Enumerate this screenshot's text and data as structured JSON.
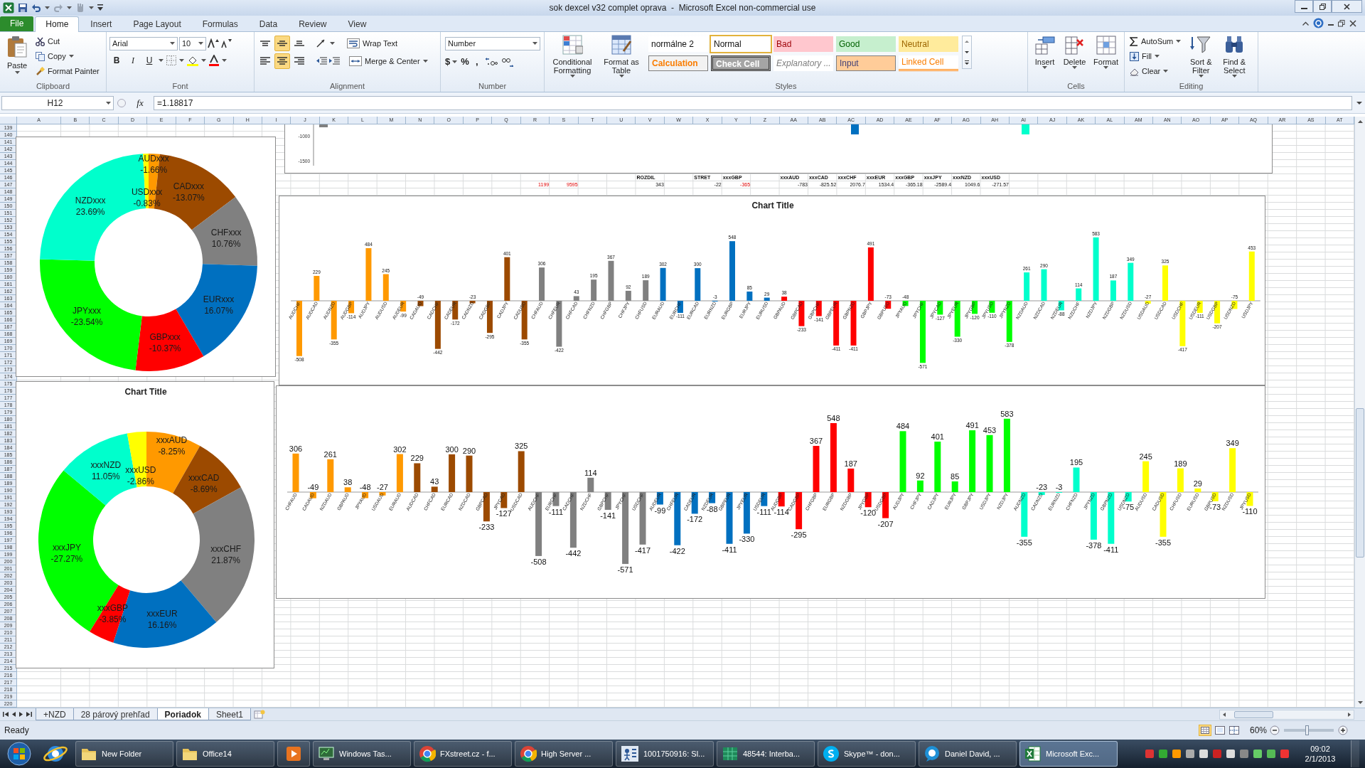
{
  "window": {
    "title": "sok dexcel v32 complet oprava  -  Microsoft Excel non-commercial use"
  },
  "ribbon_tabs": [
    {
      "label": "File",
      "kind": "file",
      "selected": false
    },
    {
      "label": "Home",
      "kind": "tab",
      "selected": true
    },
    {
      "label": "Insert",
      "kind": "tab",
      "selected": false
    },
    {
      "label": "Page Layout",
      "kind": "tab",
      "selected": false
    },
    {
      "label": "Formulas",
      "kind": "tab",
      "selected": false
    },
    {
      "label": "Data",
      "kind": "tab",
      "selected": false
    },
    {
      "label": "Review",
      "kind": "tab",
      "selected": false
    },
    {
      "label": "View",
      "kind": "tab",
      "selected": false
    }
  ],
  "clipboard": {
    "label": "Clipboard",
    "paste": "Paste",
    "cut": "Cut",
    "copy": "Copy",
    "format_painter": "Format Painter"
  },
  "font": {
    "label": "Font",
    "family": "Arial",
    "size": "10",
    "bold": "B",
    "italic": "I",
    "underline": "U"
  },
  "alignment": {
    "label": "Alignment",
    "vertical": [
      {
        "selected": false
      },
      {
        "selected": true
      },
      {
        "selected": false
      }
    ],
    "horizontal": [
      {
        "selected": false
      },
      {
        "selected": true
      },
      {
        "selected": false
      }
    ],
    "wrap_text": "Wrap Text",
    "merge_center": "Merge & Center"
  },
  "number": {
    "label": "Number",
    "format": "Number",
    "currency": "$",
    "percent": "%",
    "comma": ","
  },
  "styles": {
    "label": "Styles",
    "conditional_formatting": "Conditional Formatting",
    "format_as_table": "Format as Table",
    "gallery": [
      {
        "label": "normálne 2",
        "kind": "plain",
        "selected": false
      },
      {
        "label": "Normal",
        "kind": "normal",
        "selected": true
      },
      {
        "label": "Bad",
        "kind": "bad",
        "selected": false
      },
      {
        "label": "Good",
        "kind": "good",
        "selected": false
      },
      {
        "label": "Neutral",
        "kind": "neutral",
        "selected": false
      },
      {
        "label": "Calculation",
        "kind": "calculation",
        "selected": false
      },
      {
        "label": "Check Cell",
        "kind": "check",
        "selected": false
      },
      {
        "label": "Explanatory ...",
        "kind": "explanatory",
        "selected": false
      },
      {
        "label": "Input",
        "kind": "input",
        "selected": false
      },
      {
        "label": "Linked Cell",
        "kind": "linked",
        "selected": false
      }
    ]
  },
  "cells_group": {
    "label": "Cells",
    "insert": "Insert",
    "delete": "Delete",
    "format": "Format"
  },
  "editing": {
    "label": "Editing",
    "autosum": "AutoSum",
    "fill": "Fill",
    "clear": "Clear",
    "sort_filter": "Sort & Filter",
    "find_select": "Find & Select"
  },
  "formula_bar": {
    "name_box": "H12",
    "function_label": "fx",
    "formula": "=1.18817"
  },
  "sheet": {
    "column_headers": [
      "A",
      "B",
      "C",
      "D",
      "E",
      "F",
      "G",
      "H",
      "I",
      "J",
      "K",
      "L",
      "M",
      "N",
      "O",
      "P",
      "Q",
      "R",
      "S",
      "T",
      "U",
      "V",
      "W",
      "X",
      "Y",
      "Z",
      "AA",
      "AB",
      "AC",
      "AD",
      "AE",
      "AF",
      "AG",
      "AH",
      "AI",
      "AJ",
      "AK",
      "AL",
      "AM",
      "AN",
      "AO",
      "AP",
      "AQ",
      "AR",
      "AS",
      "AT"
    ],
    "row_numbers": [
      "139",
      "140",
      "141",
      "142",
      "143",
      "144",
      "145",
      "146",
      "147",
      "148",
      "149",
      "150",
      "151",
      "152",
      "153",
      "154",
      "155",
      "156",
      "157",
      "158",
      "159",
      "160",
      "161",
      "162",
      "163",
      "164",
      "165",
      "166",
      "167",
      "168",
      "169",
      "170",
      "171",
      "172",
      "173",
      "174",
      "175",
      "176",
      "177",
      "178",
      "179",
      "180",
      "181",
      "182",
      "183",
      "184",
      "185",
      "186",
      "187",
      "188",
      "189",
      "190",
      "191",
      "192",
      "193",
      "194",
      "195",
      "196",
      "197",
      "198",
      "199",
      "200",
      "201",
      "202",
      "203",
      "204",
      "205",
      "206",
      "207",
      "208",
      "209",
      "210",
      "211",
      "212",
      "213",
      "214",
      "215",
      "216",
      "217",
      "218",
      "219",
      "220"
    ],
    "cell_rows": [
      {
        "cells": [
          {
            "text": "ROZDIL",
            "kind": "header",
            "flagged": false
          },
          {
            "text": "STRET",
            "kind": "header",
            "flagged": false
          },
          {
            "text": "xxxGBP",
            "kind": "header",
            "flagged": false
          },
          {
            "text": "xxxAUD",
            "kind": "header",
            "flagged": false
          },
          {
            "text": "xxxCAD",
            "kind": "header",
            "flagged": false
          },
          {
            "text": "xxxCHF",
            "kind": "header",
            "flagged": false
          },
          {
            "text": "xxxEUR",
            "kind": "header",
            "flagged": false
          },
          {
            "text": "xxxGBP",
            "kind": "header",
            "flagged": false
          },
          {
            "text": "xxxJPY",
            "kind": "header",
            "flagged": false
          },
          {
            "text": "xxxNZD",
            "kind": "header",
            "flagged": false
          },
          {
            "text": "xxxUSD",
            "kind": "header",
            "flagged": false
          }
        ]
      },
      {
        "cells": [
          {
            "text": "1199",
            "kind": "value",
            "flagged": true
          },
          {
            "text": "9595",
            "kind": "value",
            "flagged": true
          },
          {
            "text": "343",
            "kind": "value",
            "flagged": false
          },
          {
            "text": "-22",
            "kind": "value",
            "flagged": false
          },
          {
            "text": "-365",
            "kind": "value",
            "flagged": true
          },
          {
            "text": "-783",
            "kind": "value",
            "flagged": false
          },
          {
            "text": "-825.52",
            "kind": "value",
            "flagged": false
          },
          {
            "text": "2076.7",
            "kind": "value",
            "flagged": false
          },
          {
            "text": "1534.4",
            "kind": "value",
            "flagged": false
          },
          {
            "text": "-365.18",
            "kind": "value",
            "flagged": false
          },
          {
            "text": "-2589.4",
            "kind": "value",
            "flagged": false
          },
          {
            "text": "1049.6",
            "kind": "value",
            "flagged": false
          },
          {
            "text": "-271.57",
            "kind": "value",
            "flagged": false
          }
        ]
      }
    ]
  },
  "chart_fragment": {
    "axis_labels": [
      "-1000",
      "-1500"
    ]
  },
  "charts": [
    {
      "slices": [
        {
          "color": "#ff9900"
        },
        {
          "color": "#9c4a00"
        },
        {
          "color": "#808080"
        },
        {
          "color": "#0070c0"
        },
        {
          "color": "#ff0000"
        },
        {
          "color": "#00ff00"
        },
        {
          "color": "#00ffcc"
        },
        {
          "color": "#ffff00"
        }
      ],
      "chart_data": {
        "type": "donut",
        "categories": [
          "AUDxxx",
          "CADxxx",
          "CHFxxx",
          "EURxxx",
          "GBPxxx",
          "JPYxxx",
          "NZDxxx",
          "USDxxx"
        ],
        "series": [
          {
            "values": [
              1.66,
              13.07,
              10.76,
              16.07,
              10.37,
              23.54,
              23.69,
              0.83
            ]
          }
        ],
        "value_labels": [
          "-1.66%",
          "-13.07%",
          "10.76%",
          "16.07%",
          "-10.37%",
          "-23.54%",
          "23.69%",
          "-0.83%"
        ]
      }
    },
    {
      "chart_data": {
        "type": "bar",
        "title": "Chart Title",
        "categories": [
          "AUDCHF",
          "AUDCAD",
          "AUDNZD",
          "AUDGBP",
          "AUDJPY",
          "AUDUSD",
          "AUDEUR",
          "CADAUD",
          "CADCHF",
          "CADEUR",
          "CADNZD",
          "CADGBP",
          "CADJPY",
          "CADUSD",
          "CHFAUD",
          "CHFEUR",
          "CHFCAD",
          "CHFNZD",
          "CHFGBP",
          "CHFJPY",
          "CHFUSD",
          "EURAUD",
          "EURCHF",
          "EURCAD",
          "EURNZD",
          "EURGBP",
          "EURJPY",
          "EURUSD",
          "GBPAUD",
          "GBPCAD",
          "GBPCHF",
          "GBPEUR",
          "GBPNZD",
          "GBPJPY",
          "GBPUSD",
          "JPYAUD",
          "JPYCHF",
          "JPYCAD",
          "JPYEUR",
          "JPYGBP",
          "JPYUSD",
          "JPYNZD",
          "NZDAUD",
          "NZDCAD",
          "NZDEUR",
          "NZDCHF",
          "NZDJPY",
          "NZDGBP",
          "NZDUSD",
          "USDAUD",
          "USDCAD",
          "USDCHF",
          "USDEUR",
          "USDGBP",
          "USDNZD",
          "USDJPY"
        ],
        "series": [
          {
            "color": "#ff9900",
            "values": [
              -508,
              229,
              -355,
              -114,
              484,
              245,
              -99,
              null,
              null,
              null,
              null,
              null,
              null,
              null,
              null,
              null,
              null,
              null,
              null,
              null,
              null,
              null,
              null,
              null,
              null,
              null,
              null,
              null,
              null,
              null,
              null,
              null,
              null,
              null,
              null,
              null,
              null,
              null,
              null,
              null,
              null,
              null,
              null,
              null,
              null,
              null,
              null,
              null,
              null,
              null,
              null,
              null,
              null,
              null,
              null,
              null
            ]
          },
          {
            "color": "#9c4a00",
            "values": [
              null,
              null,
              null,
              null,
              null,
              null,
              null,
              -49,
              -442,
              -172,
              -23,
              -295,
              401,
              -355,
              null,
              null,
              null,
              null,
              null,
              null,
              null,
              null,
              null,
              null,
              null,
              null,
              null,
              null,
              null,
              null,
              null,
              null,
              null,
              null,
              null,
              null,
              null,
              null,
              null,
              null,
              null,
              null,
              null,
              null,
              null,
              null,
              null,
              null,
              null,
              null,
              null,
              null,
              null,
              null,
              null,
              null
            ]
          },
          {
            "color": "#808080",
            "values": [
              null,
              null,
              null,
              null,
              null,
              null,
              null,
              null,
              null,
              null,
              null,
              null,
              null,
              null,
              306,
              -422,
              43,
              195,
              367,
              92,
              189,
              null,
              null,
              null,
              null,
              null,
              null,
              null,
              null,
              null,
              null,
              null,
              null,
              null,
              null,
              null,
              null,
              null,
              null,
              null,
              null,
              null,
              null,
              null,
              null,
              null,
              null,
              null,
              null,
              null,
              null,
              null,
              null,
              null,
              null,
              null
            ]
          },
          {
            "color": "#0070c0",
            "values": [
              null,
              null,
              null,
              null,
              null,
              null,
              null,
              null,
              null,
              null,
              null,
              null,
              null,
              null,
              null,
              null,
              null,
              null,
              null,
              null,
              null,
              302,
              -111,
              300,
              -3,
              548,
              85,
              29,
              null,
              null,
              null,
              null,
              null,
              null,
              null,
              null,
              null,
              null,
              null,
              null,
              null,
              null,
              null,
              null,
              null,
              null,
              null,
              null,
              null,
              null,
              null,
              null,
              null,
              null,
              null,
              null
            ]
          },
          {
            "color": "#ff0000",
            "values": [
              null,
              null,
              null,
              null,
              null,
              null,
              null,
              null,
              null,
              null,
              null,
              null,
              null,
              null,
              null,
              null,
              null,
              null,
              null,
              null,
              null,
              null,
              null,
              null,
              null,
              null,
              null,
              null,
              38,
              -233,
              -141,
              -411,
              -411,
              491,
              -73,
              null,
              null,
              null,
              null,
              null,
              null,
              null,
              null,
              null,
              null,
              null,
              null,
              null,
              null,
              null,
              null,
              null,
              null,
              null,
              null,
              null
            ]
          },
          {
            "color": "#00ff00",
            "values": [
              null,
              null,
              null,
              null,
              null,
              null,
              null,
              null,
              null,
              null,
              null,
              null,
              null,
              null,
              null,
              null,
              null,
              null,
              null,
              null,
              null,
              null,
              null,
              null,
              null,
              null,
              null,
              null,
              null,
              null,
              null,
              null,
              null,
              null,
              null,
              -48,
              -571,
              -127,
              -330,
              -120,
              -110,
              -378,
              null,
              null,
              null,
              null,
              null,
              null,
              null,
              null,
              null,
              null,
              null,
              null,
              null,
              null
            ]
          },
          {
            "color": "#00ffcc",
            "values": [
              null,
              null,
              null,
              null,
              null,
              null,
              null,
              null,
              null,
              null,
              null,
              null,
              null,
              null,
              null,
              null,
              null,
              null,
              null,
              null,
              null,
              null,
              null,
              null,
              null,
              null,
              null,
              null,
              null,
              null,
              null,
              null,
              null,
              null,
              null,
              null,
              null,
              null,
              null,
              null,
              null,
              null,
              261,
              290,
              -88,
              114,
              583,
              187,
              349,
              null,
              null,
              null,
              null,
              null,
              null,
              null
            ]
          },
          {
            "color": "#ffff00",
            "values": [
              null,
              null,
              null,
              null,
              null,
              null,
              null,
              null,
              null,
              null,
              null,
              null,
              null,
              null,
              null,
              null,
              null,
              null,
              null,
              null,
              null,
              null,
              null,
              null,
              null,
              null,
              null,
              null,
              null,
              null,
              null,
              null,
              null,
              null,
              null,
              null,
              null,
              null,
              null,
              null,
              null,
              null,
              null,
              null,
              null,
              null,
              null,
              null,
              null,
              -27,
              325,
              -417,
              -111,
              -207,
              -75,
              453
            ]
          }
        ],
        "data_labels": true
      }
    },
    {
      "slices": [
        {
          "color": "#ff9900"
        },
        {
          "color": "#9c4a00"
        },
        {
          "color": "#808080"
        },
        {
          "color": "#0070c0"
        },
        {
          "color": "#ff0000"
        },
        {
          "color": "#00ff00"
        },
        {
          "color": "#00ffcc"
        },
        {
          "color": "#ffff00"
        }
      ],
      "chart_data": {
        "type": "donut",
        "title": "Chart Title",
        "categories": [
          "xxxAUD",
          "xxxCAD",
          "xxxCHF",
          "xxxEUR",
          "xxxGBP",
          "xxxJPY",
          "xxxNZD",
          "xxxUSD"
        ],
        "series": [
          {
            "values": [
              8.25,
              8.69,
              21.87,
              16.16,
              3.85,
              27.27,
              11.05,
              2.86
            ]
          }
        ],
        "value_labels": [
          "-8.25%",
          "-8.69%",
          "21.87%",
          "16.16%",
          "-3.85%",
          "-27.27%",
          "11.05%",
          "-2.86%"
        ]
      }
    },
    {
      "chart_data": {
        "type": "bar",
        "categories": [
          "CHFAUD",
          "CADAUD",
          "NZDAUD",
          "GBPAUD",
          "JPYAUD",
          "USDAUD",
          "EURAUD",
          "AUDCAD",
          "CHFCAD",
          "EURCAD",
          "NZDCAD",
          "GBPCAD",
          "JPYCAD",
          "USDCAD",
          "AUDCHF",
          "EURCHF",
          "CADCHF",
          "NZDCHF",
          "GBPCHF",
          "JPYCHF",
          "USDCHF",
          "AUDEUR",
          "CHFEUR",
          "CADEUR",
          "NZDEUR",
          "GBPEUR",
          "JPYEUR",
          "USDEUR",
          "AUDGBP",
          "CADGBP",
          "CHFGBP",
          "EURGBP",
          "NZDGBP",
          "JPYGBP",
          "USDGBP",
          "AUDJPY",
          "CHFJPY",
          "CADJPY",
          "EURJPY",
          "GBPJPY",
          "USDJPY",
          "NZDJPY",
          "AUDNZD",
          "CADNZD",
          "EURNZD",
          "CHFNZD",
          "JPYNZD",
          "GBPNZD",
          "USDNZD",
          "AUDUSD",
          "CADUSD",
          "CHFUSD",
          "EURUSD",
          "GBPUSD",
          "NZDUSD",
          "JPYUSD"
        ],
        "series": [
          {
            "color": "#ff9900",
            "values": [
              306,
              -49,
              261,
              38,
              -48,
              -27,
              302,
              null,
              null,
              null,
              null,
              null,
              null,
              null,
              null,
              null,
              null,
              null,
              null,
              null,
              null,
              null,
              null,
              null,
              null,
              null,
              null,
              null,
              null,
              null,
              null,
              null,
              null,
              null,
              null,
              null,
              null,
              null,
              null,
              null,
              null,
              null,
              null,
              null,
              null,
              null,
              null,
              null,
              null,
              null,
              null,
              null,
              null,
              null,
              null,
              null
            ]
          },
          {
            "color": "#9c4a00",
            "values": [
              null,
              null,
              null,
              null,
              null,
              null,
              null,
              229,
              43,
              300,
              290,
              -233,
              -127,
              325,
              null,
              null,
              null,
              null,
              null,
              null,
              null,
              null,
              null,
              null,
              null,
              null,
              null,
              null,
              null,
              null,
              null,
              null,
              null,
              null,
              null,
              null,
              null,
              null,
              null,
              null,
              null,
              null,
              null,
              null,
              null,
              null,
              null,
              null,
              null,
              null,
              null,
              null,
              null,
              null,
              null,
              null
            ]
          },
          {
            "color": "#808080",
            "values": [
              null,
              null,
              null,
              null,
              null,
              null,
              null,
              null,
              null,
              null,
              null,
              null,
              null,
              null,
              -508,
              -111,
              -442,
              114,
              -141,
              -571,
              -417,
              null,
              null,
              null,
              null,
              null,
              null,
              null,
              null,
              null,
              null,
              null,
              null,
              null,
              null,
              null,
              null,
              null,
              null,
              null,
              null,
              null,
              null,
              null,
              null,
              null,
              null,
              null,
              null,
              null,
              null,
              null,
              null,
              null,
              null,
              null
            ]
          },
          {
            "color": "#0070c0",
            "values": [
              null,
              null,
              null,
              null,
              null,
              null,
              null,
              null,
              null,
              null,
              null,
              null,
              null,
              null,
              null,
              null,
              null,
              null,
              null,
              null,
              null,
              -99,
              -422,
              -172,
              -88,
              -411,
              -330,
              -111,
              null,
              null,
              null,
              null,
              null,
              null,
              null,
              null,
              null,
              null,
              null,
              null,
              null,
              null,
              null,
              null,
              null,
              null,
              null,
              null,
              null,
              null,
              null,
              null,
              null,
              null,
              null,
              null
            ]
          },
          {
            "color": "#ff0000",
            "values": [
              null,
              null,
              null,
              null,
              null,
              null,
              null,
              null,
              null,
              null,
              null,
              null,
              null,
              null,
              null,
              null,
              null,
              null,
              null,
              null,
              null,
              null,
              null,
              null,
              null,
              null,
              null,
              null,
              -114,
              -295,
              367,
              548,
              187,
              -120,
              -207,
              null,
              null,
              null,
              null,
              null,
              null,
              null,
              null,
              null,
              null,
              null,
              null,
              null,
              null,
              null,
              null,
              null,
              null,
              null,
              null,
              null
            ]
          },
          {
            "color": "#00ff00",
            "values": [
              null,
              null,
              null,
              null,
              null,
              null,
              null,
              null,
              null,
              null,
              null,
              null,
              null,
              null,
              null,
              null,
              null,
              null,
              null,
              null,
              null,
              null,
              null,
              null,
              null,
              null,
              null,
              null,
              null,
              null,
              null,
              null,
              null,
              null,
              null,
              484,
              92,
              401,
              85,
              491,
              453,
              583,
              null,
              null,
              null,
              null,
              null,
              null,
              null,
              null,
              null,
              null,
              null,
              null,
              null,
              null
            ]
          },
          {
            "color": "#00ffcc",
            "values": [
              null,
              null,
              null,
              null,
              null,
              null,
              null,
              null,
              null,
              null,
              null,
              null,
              null,
              null,
              null,
              null,
              null,
              null,
              null,
              null,
              null,
              null,
              null,
              null,
              null,
              null,
              null,
              null,
              null,
              null,
              null,
              null,
              null,
              null,
              null,
              null,
              null,
              null,
              null,
              null,
              null,
              null,
              -355,
              -23,
              -3,
              195,
              -378,
              -411,
              -75,
              null,
              null,
              null,
              null,
              null,
              null,
              null
            ]
          },
          {
            "color": "#ffff00",
            "values": [
              null,
              null,
              null,
              null,
              null,
              null,
              null,
              null,
              null,
              null,
              null,
              null,
              null,
              null,
              null,
              null,
              null,
              null,
              null,
              null,
              null,
              null,
              null,
              null,
              null,
              null,
              null,
              null,
              null,
              null,
              null,
              null,
              null,
              null,
              null,
              null,
              null,
              null,
              null,
              null,
              null,
              null,
              null,
              null,
              null,
              null,
              null,
              null,
              null,
              245,
              -355,
              189,
              29,
              -73,
              349,
              -110
            ]
          }
        ],
        "data_labels": true
      }
    }
  ],
  "sheet_tabs": [
    {
      "label": "+NZD",
      "selected": false
    },
    {
      "label": "28 párový prehľad",
      "selected": false
    },
    {
      "label": "Poriadok",
      "selected": true
    },
    {
      "label": "Sheet1",
      "selected": false
    }
  ],
  "status_bar": {
    "status": "Ready",
    "zoom": "60%",
    "zoom_slider": {
      "level": 0.45
    }
  },
  "taskbar": {
    "items": [
      {
        "label": "New Folder",
        "kind": "folder",
        "selected": false
      },
      {
        "label": "Office14",
        "kind": "folder",
        "selected": false
      },
      {
        "kind": "media",
        "selected": false
      },
      {
        "label": "Windows Tas...",
        "kind": "monitor",
        "selected": false
      },
      {
        "label": "FXstreet.cz - f...",
        "kind": "chrome",
        "selected": false
      },
      {
        "label": "High Server ...",
        "kind": "chrome",
        "selected": false
      },
      {
        "label": "1001750916: Sl...",
        "kind": "sig",
        "selected": false
      },
      {
        "label": "48544: Interba...",
        "kind": "sheet",
        "selected": false
      },
      {
        "label": "Skype™ - don...",
        "kind": "skype",
        "selected": false
      },
      {
        "label": "Daniel David, ...",
        "kind": "chat",
        "selected": false
      },
      {
        "label": "Microsoft Exc...",
        "kind": "excel",
        "selected": true
      }
    ],
    "time": "09:02",
    "date": "2/1/2013"
  }
}
